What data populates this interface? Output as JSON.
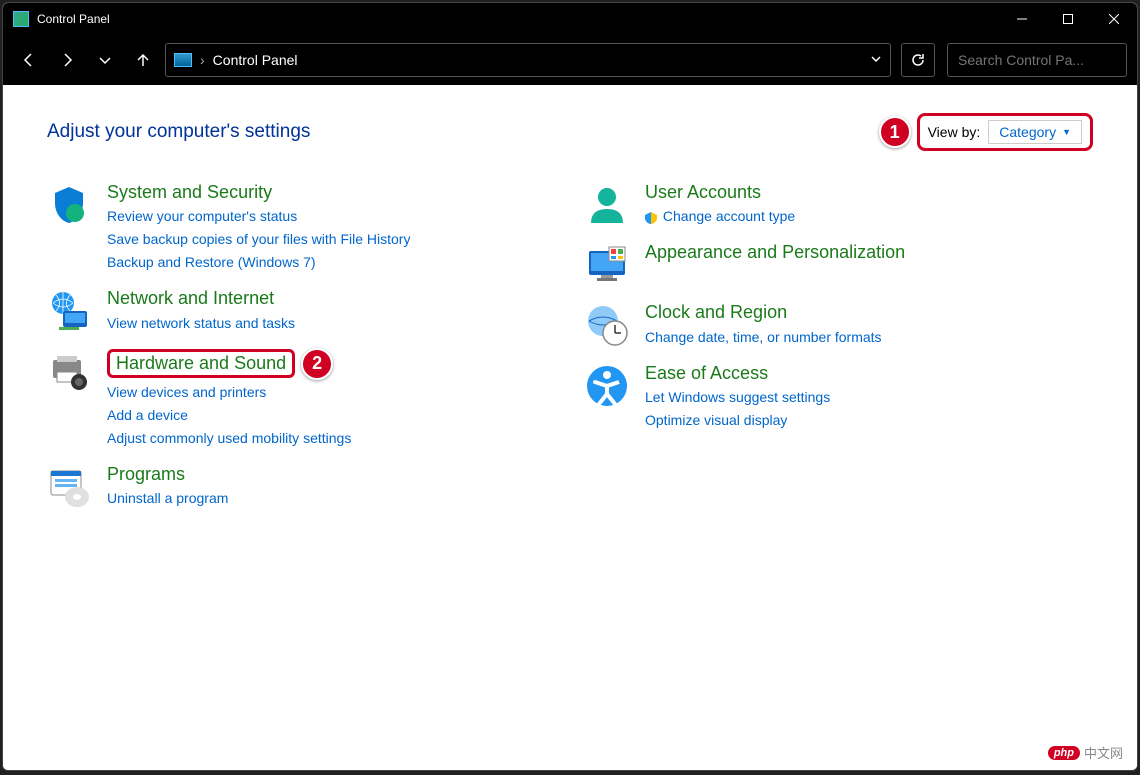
{
  "window": {
    "title": "Control Panel"
  },
  "address": {
    "path": "Control Panel"
  },
  "search": {
    "placeholder": "Search Control Pa..."
  },
  "heading": "Adjust your computer's settings",
  "viewby": {
    "label": "View by:",
    "value": "Category"
  },
  "annotations": {
    "one": "1",
    "two": "2"
  },
  "left": {
    "system": {
      "title": "System and Security",
      "links": [
        "Review your computer's status",
        "Save backup copies of your files with File History",
        "Backup and Restore (Windows 7)"
      ]
    },
    "network": {
      "title": "Network and Internet",
      "links": [
        "View network status and tasks"
      ]
    },
    "hardware": {
      "title": "Hardware and Sound",
      "links": [
        "View devices and printers",
        "Add a device",
        "Adjust commonly used mobility settings"
      ]
    },
    "programs": {
      "title": "Programs",
      "links": [
        "Uninstall a program"
      ]
    }
  },
  "right": {
    "users": {
      "title": "User Accounts",
      "links": [
        "Change account type"
      ]
    },
    "appearance": {
      "title": "Appearance and Personalization"
    },
    "clock": {
      "title": "Clock and Region",
      "links": [
        "Change date, time, or number formats"
      ]
    },
    "ease": {
      "title": "Ease of Access",
      "links": [
        "Let Windows suggest settings",
        "Optimize visual display"
      ]
    }
  },
  "watermark": {
    "badge": "php",
    "text": "中文网"
  }
}
